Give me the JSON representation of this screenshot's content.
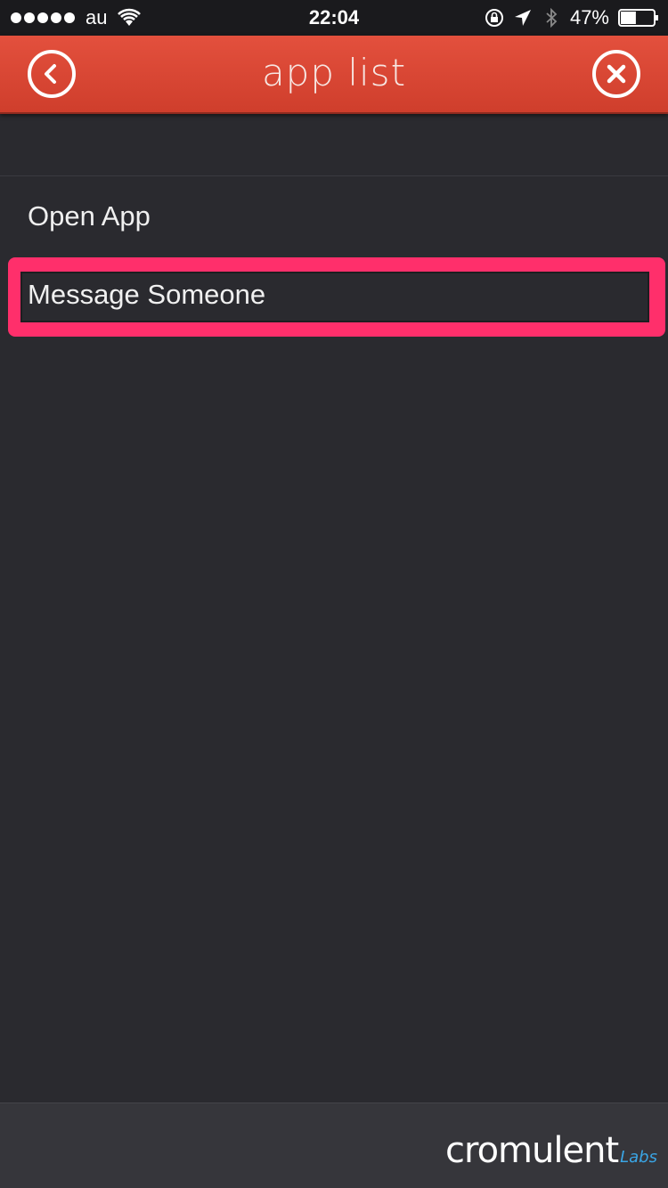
{
  "status_bar": {
    "carrier": "au",
    "time": "22:04",
    "battery_percent": "47%",
    "battery_level": 0.47
  },
  "nav": {
    "title": "app list",
    "back_icon": "chevron-left-circle-icon",
    "close_icon": "close-circle-icon"
  },
  "list": {
    "items": [
      {
        "label": "Open App"
      },
      {
        "label": "Message Someone",
        "highlighted": true
      }
    ]
  },
  "footer": {
    "brand_name": "cromulent",
    "brand_sub": "Labs"
  },
  "colors": {
    "nav_red": "#d9452f",
    "background": "#2a2a2f",
    "highlight": "#ff2f6b",
    "brand_accent": "#3aa6e6"
  }
}
